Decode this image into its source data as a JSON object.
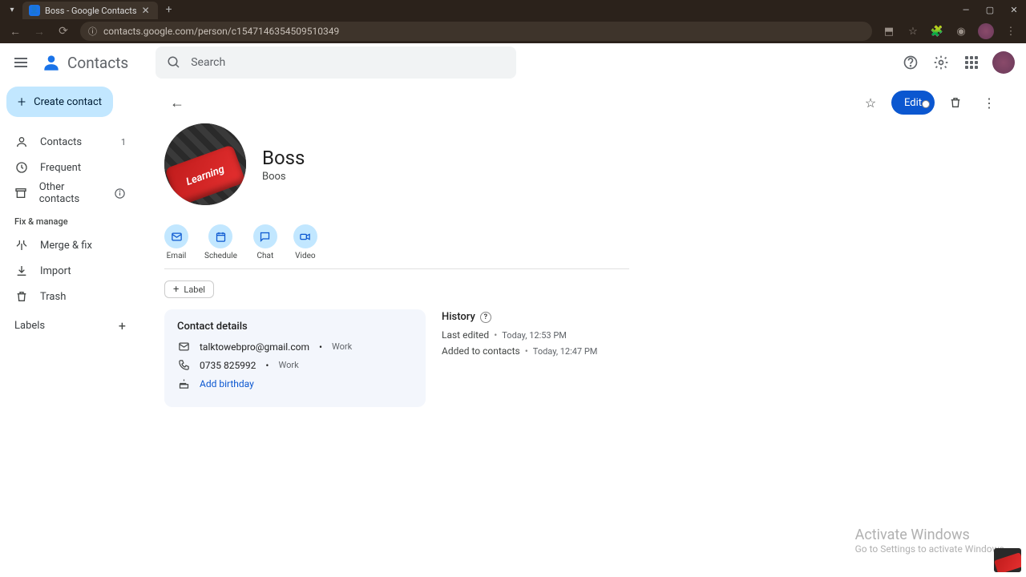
{
  "browser": {
    "tab_title": "Boss - Google Contacts",
    "url": "contacts.google.com/person/c1547146354509510349"
  },
  "app_header": {
    "app_name": "Contacts",
    "search_placeholder": "Search"
  },
  "sidebar": {
    "create_label": "Create contact",
    "items": {
      "contacts": {
        "label": "Contacts",
        "count": "1"
      },
      "frequent": {
        "label": "Frequent"
      },
      "other": {
        "label": "Other contacts"
      }
    },
    "fix_heading": "Fix & manage",
    "manage": {
      "merge": {
        "label": "Merge & fix"
      },
      "import": {
        "label": "Import"
      },
      "trash": {
        "label": "Trash"
      }
    },
    "labels_heading": "Labels"
  },
  "contact": {
    "name": "Boss",
    "subtitle": "Boos",
    "avatar_text": "Learning",
    "edit_label": "Edit",
    "quick_actions": {
      "email": "Email",
      "schedule": "Schedule",
      "chat": "Chat",
      "video": "Video"
    },
    "label_chip": "Label",
    "details": {
      "heading": "Contact details",
      "email": "talktowebpro@gmail.com",
      "email_tag": "Work",
      "phone": "0735 825992",
      "phone_tag": "Work",
      "birthday_link": "Add birthday"
    },
    "history": {
      "heading": "History",
      "last_edited_label": "Last edited",
      "last_edited_time": "Today, 12:53 PM",
      "added_label": "Added to contacts",
      "added_time": "Today, 12:47 PM"
    }
  },
  "watermark": {
    "line1": "Activate Windows",
    "line2": "Go to Settings to activate Windows."
  }
}
